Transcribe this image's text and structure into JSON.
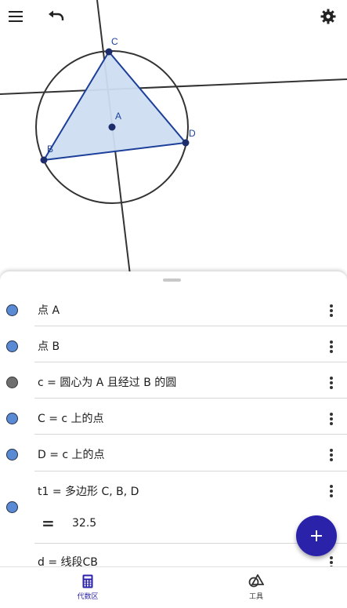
{
  "toolbar": {
    "menu_icon": "hamburger-menu-icon",
    "undo_icon": "undo-icon",
    "settings_icon": "gear-icon"
  },
  "graphics": {
    "point_labels": {
      "A": "A",
      "B": "B",
      "C": "C",
      "D": "D"
    },
    "colors": {
      "polygon_fill": "#cdddf1",
      "polygon_stroke": "#1c3f9a",
      "point": "#1d2d6b",
      "circle": "#333333",
      "line": "#333333"
    }
  },
  "algebra": {
    "items": [
      {
        "label": "点 A",
        "dot_color": "blue"
      },
      {
        "label": "点 B",
        "dot_color": "blue"
      },
      {
        "label": "c = 圆心为 A 且经过 B 的圆",
        "dot_color": "gray"
      },
      {
        "label": "C = c 上的点",
        "dot_color": "blue"
      },
      {
        "label": "D = c 上的点",
        "dot_color": "blue"
      },
      {
        "label": "t1 = 多边形 C, B, D",
        "dot_color": "blue",
        "eq_symbol": "=",
        "value": "32.5"
      },
      {
        "label": "d = 线段CB",
        "dot_color": "blue"
      }
    ],
    "add_icon": "plus-icon"
  },
  "nav": {
    "algebra": {
      "label": "代数区",
      "icon": "calculator-icon",
      "active": true
    },
    "tools": {
      "label": "工具",
      "icon": "shapes-tools-icon",
      "active": false
    }
  },
  "accent_color": "#2a23a9"
}
